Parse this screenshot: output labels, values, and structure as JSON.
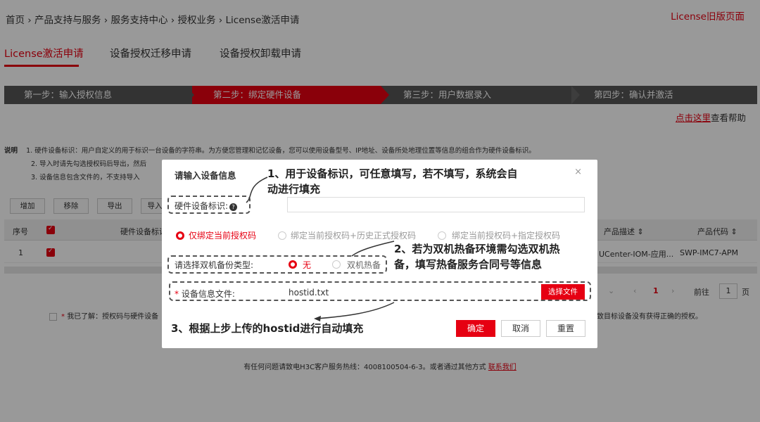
{
  "breadcrumb": [
    "首页",
    "产品支持与服务",
    "服务支持中心",
    "授权业务",
    "License激活申请"
  ],
  "breadcrumb_sep": "›",
  "old_link": "License旧版页面",
  "tabs": [
    "License激活申请",
    "设备授权迁移申请",
    "设备授权卸载申请"
  ],
  "steps": [
    "第一步：输入授权信息",
    "第二步：绑定硬件设备",
    "第三步：用户数据录入",
    "第四步：确认并激活"
  ],
  "help": {
    "link": "点击这里",
    "text": "查看帮助"
  },
  "notes": {
    "label": "说明",
    "items": [
      "1. 硬件设备标识：用户自定义的用于标识一台设备的字符串。为方便您管理和记忆设备，您可以使用设备型号、IP地址、设备所处地理位置等信息的组合作为硬件设备标识。",
      "2. 导入时请先勾选授权码后导出，然后",
      "3. 设备信息包含文件的，不支持导入"
    ]
  },
  "toolbar": [
    "增加",
    "移除",
    "导出",
    "导入"
  ],
  "table": {
    "headers": {
      "seq": "序号",
      "hw": "硬件设备标识",
      "desc": "产品描述 ⇕",
      "code": "产品代码 ⇕"
    },
    "rows": [
      {
        "seq": "1",
        "desc": "UCenter-IOM-应用...",
        "code": "SWP-IMC7-APM"
      }
    ]
  },
  "pager": {
    "page": "1",
    "goto": "前往",
    "input": "1",
    "unit": "页"
  },
  "agree": {
    "star": "*",
    "text": "我已了解：授权码与硬件设备",
    "tail": "致目标设备没有获得正确的授权。"
  },
  "footer": {
    "text": "有任何问题请致电H3C客户服务热线：4008100504-6-3。或者通过其他方式",
    "link": "联系我们"
  },
  "modal": {
    "title": "请输入设备信息",
    "close": "×",
    "hw_label": "硬件设备标识:",
    "radios": [
      "仅绑定当前授权码",
      "绑定当前授权码+历史正式授权码",
      "绑定当前授权码+指定授权码"
    ],
    "backup_label": "请选择双机备份类型:",
    "backup_options": [
      "无",
      "双机热备"
    ],
    "file_label": "设备信息文件:",
    "file_required": "*",
    "file_value": "hostid.txt",
    "choose_file": "选择文件",
    "buttons": {
      "confirm": "确定",
      "cancel": "取消",
      "reset": "重置"
    }
  },
  "annotations": {
    "a1_line1": "1、用于设备标识，可任意填写，若不填写，系统会自",
    "a1_line2": "动进行填充",
    "a2_line1": "2、若为双机热备环境需勾选双机热",
    "a2_line2": "备，填写热备服务合同号等信息",
    "a3": "3、根据上步上传的hostid进行自动填充"
  },
  "colors": {
    "accent": "#e60012",
    "step_bar": "#555555"
  }
}
